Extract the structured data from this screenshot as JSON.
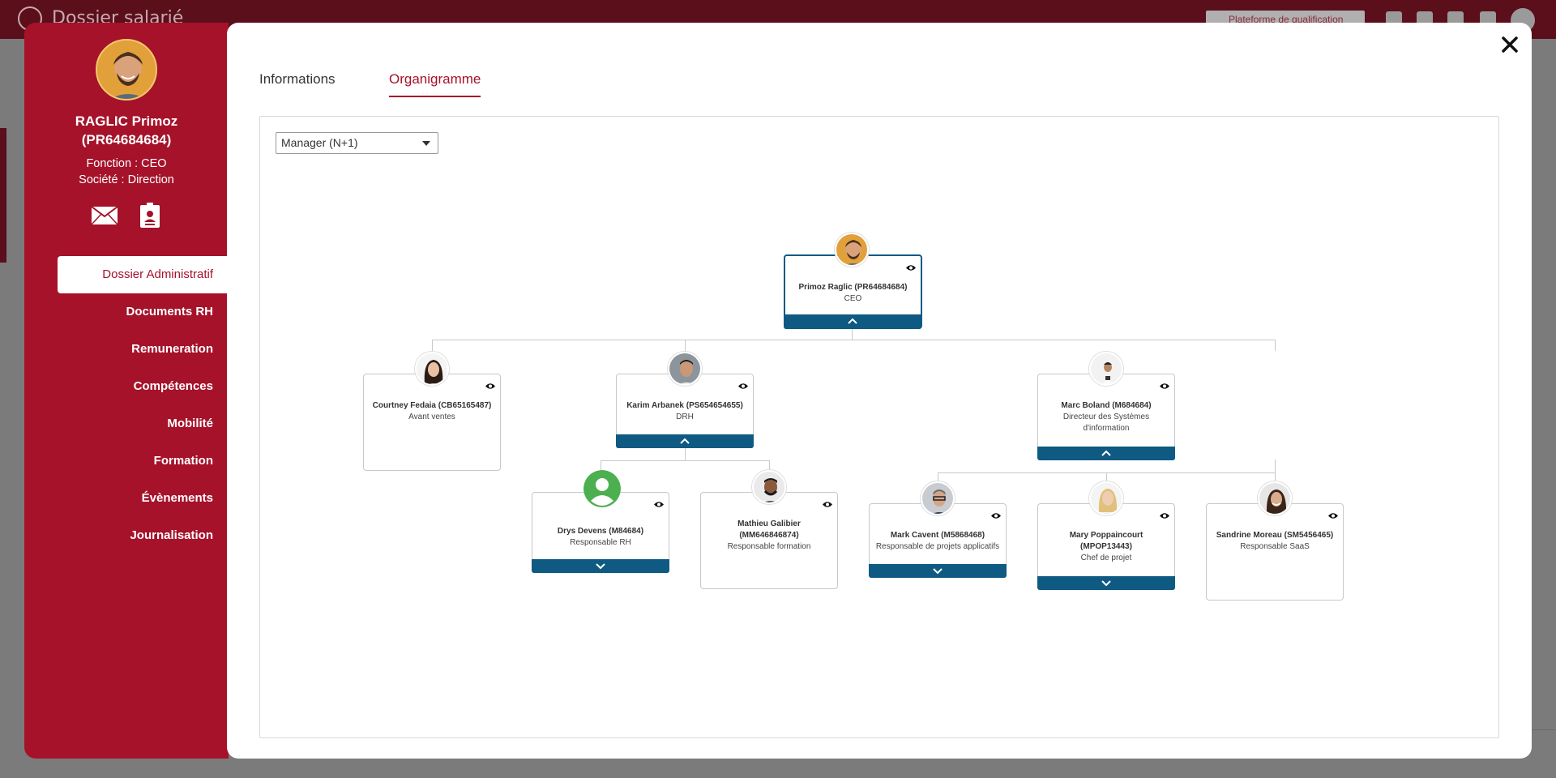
{
  "background": {
    "title": "Dossier salarié",
    "pill_label": "Plateforme de qualification"
  },
  "profile": {
    "name_line1": "RAGLIC Primoz",
    "name_line2": "(PR64684684)",
    "fonction": "Fonction : CEO",
    "societe": "Société : Direction"
  },
  "nav": {
    "items": [
      {
        "label": "Dossier Administratif"
      },
      {
        "label": "Documents RH"
      },
      {
        "label": "Remuneration"
      },
      {
        "label": "Compétences"
      },
      {
        "label": "Mobilité"
      },
      {
        "label": "Formation"
      },
      {
        "label": "Évènements"
      },
      {
        "label": "Journalisation"
      }
    ]
  },
  "tabs": [
    {
      "label": "Informations"
    },
    {
      "label": "Organigramme"
    }
  ],
  "select": {
    "value": "Manager (N+1)"
  },
  "org": {
    "root": {
      "name": "Primoz Raglic (PR64684684)",
      "role": "CEO"
    },
    "courtney": {
      "name": "Courtney Fedaia (CB65165487)",
      "role": "Avant ventes"
    },
    "karim": {
      "name": "Karim Arbanek (PS654654655)",
      "role": "DRH"
    },
    "marc": {
      "name": "Marc Boland (M684684)",
      "role_l1": "Directeur des Systèmes",
      "role_l2": "d'information"
    },
    "drys": {
      "name": "Drys Devens (M84684)",
      "role": "Responsable RH"
    },
    "mathieu": {
      "name_l1": "Mathieu Galibier",
      "name_l2": "(MM646846874)",
      "role": "Responsable formation"
    },
    "mark": {
      "name": "Mark Cavent (M5868468)",
      "role": "Responsable de projets applicatifs"
    },
    "mary": {
      "name_l1": "Mary Poppaincourt",
      "name_l2": "(MPOP13443)",
      "role": "Chef de projet"
    },
    "sandrine": {
      "name": "Sandrine Moreau (SM5456465)",
      "role": "Responsable SaaS"
    }
  },
  "colors": {
    "brand": "#a5122a",
    "toggle": "#0e5a82"
  }
}
